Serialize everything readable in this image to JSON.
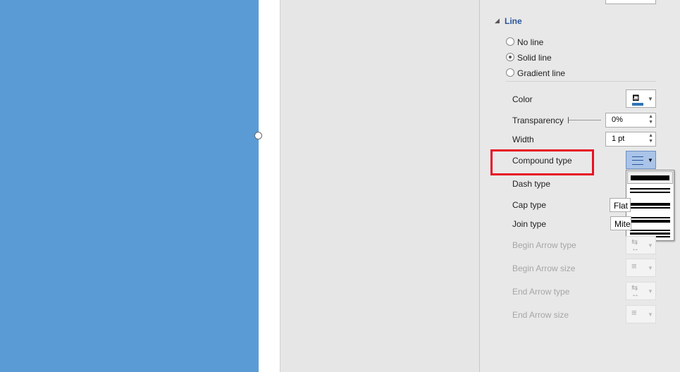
{
  "section": {
    "title": "Line",
    "collapse_icon": "triangle-down-icon"
  },
  "radios": [
    {
      "label": "No line",
      "key": "N",
      "checked": false
    },
    {
      "label": "Solid line",
      "key": "S",
      "checked": true
    },
    {
      "label": "Gradient line",
      "key": "G",
      "checked": false
    }
  ],
  "rows": {
    "color": {
      "label": "Color",
      "icon": "paint-bucket-icon",
      "swatch": "#2e75b6"
    },
    "transparency": {
      "label": "Transparency",
      "value": "0%",
      "slider_percent": 0
    },
    "width": {
      "label": "Width",
      "value": "1 pt"
    },
    "compound": {
      "label": "Compound type",
      "icon": "compound-lines-icon"
    },
    "dash": {
      "label": "Dash type"
    },
    "cap": {
      "label": "Cap type",
      "value": "Flat"
    },
    "join": {
      "label": "Join type",
      "value": "Miter"
    },
    "begin_arrow_type": {
      "label": "Begin Arrow type",
      "disabled": true
    },
    "begin_arrow_size": {
      "label": "Begin Arrow size",
      "disabled": true
    },
    "end_arrow_type": {
      "label": "End Arrow type",
      "disabled": true
    },
    "end_arrow_size": {
      "label": "End Arrow size",
      "disabled": true
    }
  },
  "compound_options": [
    "Simple",
    "Double",
    "Thick thin",
    "Thin thick",
    "Triple"
  ],
  "colors": {
    "shape_fill": "#5b9bd5",
    "highlight": "#e81123",
    "button_active": "#a9c4e8"
  }
}
